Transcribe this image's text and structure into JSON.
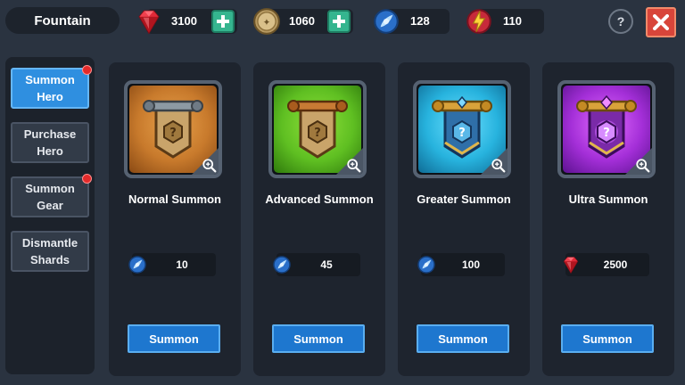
{
  "header": {
    "title": "Fountain",
    "gems": "3100",
    "coins": "1060",
    "summon_scrolls": "128",
    "energy": "110",
    "help_label": "?"
  },
  "sidebar": {
    "items": [
      {
        "label": "Summon Hero",
        "active": true,
        "notification": true
      },
      {
        "label": "Purchase Hero",
        "active": false,
        "notification": false
      },
      {
        "label": "Summon Gear",
        "active": false,
        "notification": true
      },
      {
        "label": "Dismantle Shards",
        "active": false,
        "notification": false
      }
    ]
  },
  "cards": [
    {
      "name": "Normal Summon",
      "cost": "10",
      "currency_icon": "summon-scroll-icon",
      "button_label": "Summon",
      "theme_color": "#c87a2c"
    },
    {
      "name": "Advanced Summon",
      "cost": "45",
      "currency_icon": "summon-scroll-icon",
      "button_label": "Summon",
      "theme_color": "#5fbf22"
    },
    {
      "name": "Greater Summon",
      "cost": "100",
      "currency_icon": "summon-scroll-icon",
      "button_label": "Summon",
      "theme_color": "#27b3de"
    },
    {
      "name": "Ultra Summon",
      "cost": "2500",
      "currency_icon": "ruby-gem-icon",
      "button_label": "Summon",
      "theme_color": "#a42fd8"
    }
  ],
  "colors": {
    "background": "#2a3340",
    "panel": "#1e242e",
    "active_tab": "#2f8fe0",
    "summon_button": "#1e77cf",
    "plus_button": "#35b58f",
    "close_button": "#d8453a",
    "notification": "#e32a2a"
  }
}
